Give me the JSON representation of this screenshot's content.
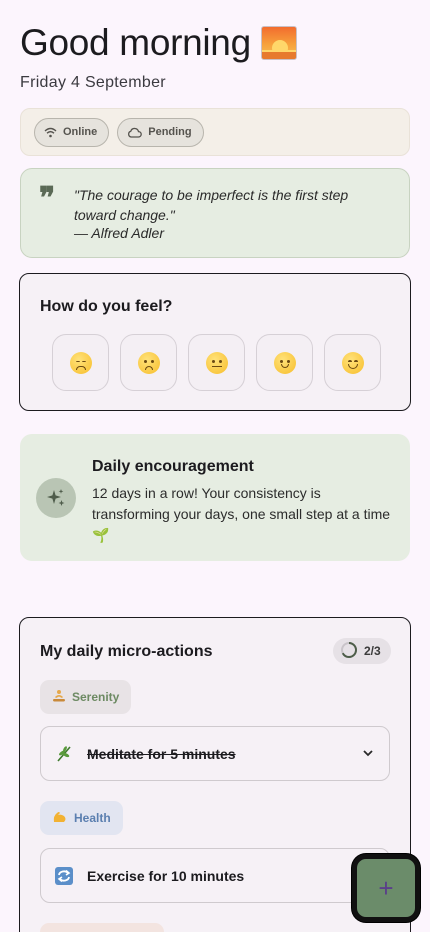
{
  "header": {
    "greeting": "Good morning",
    "greeting_icon": "sunrise-emoji-icon",
    "date": "Friday 4 September"
  },
  "status": {
    "online_label": "Online",
    "online_icon": "wifi-icon",
    "pending_label": "Pending",
    "pending_icon": "cloud-icon"
  },
  "quote": {
    "text": "\"The courage to be imperfect is the first step toward change.\"",
    "author": "— Alfred Adler"
  },
  "feel": {
    "title": "How do you feel?",
    "moods": [
      "very-sad-face-icon",
      "sad-face-icon",
      "neutral-face-icon",
      "slight-smile-face-icon",
      "happy-face-icon"
    ]
  },
  "encouragement": {
    "title": "Daily encouragement",
    "text": "12 days in a row! Your consistency is transforming your days, one small step at a time 🌱",
    "icon": "sparkles-icon"
  },
  "actions": {
    "title": "My daily micro-actions",
    "progress_label": "2/3",
    "progress_fraction": 0.67,
    "categories": [
      {
        "name": "Serenity",
        "icon": "person-meditating-icon",
        "color": "#6d8a63"
      },
      {
        "name": "Health",
        "icon": "flexed-biceps-icon",
        "color": "#5b7fb0"
      }
    ],
    "items": [
      {
        "label": "Meditate for 5 minutes",
        "icon": "herb-icon",
        "done": true
      },
      {
        "label": "Exercise for 10 minutes",
        "icon": "repeat-icon",
        "done": false
      }
    ]
  },
  "fab": {
    "label": "+"
  },
  "colors": {
    "background": "#fcf5fd",
    "sage": "#e6ede2",
    "fab": "#6b8c6a"
  }
}
